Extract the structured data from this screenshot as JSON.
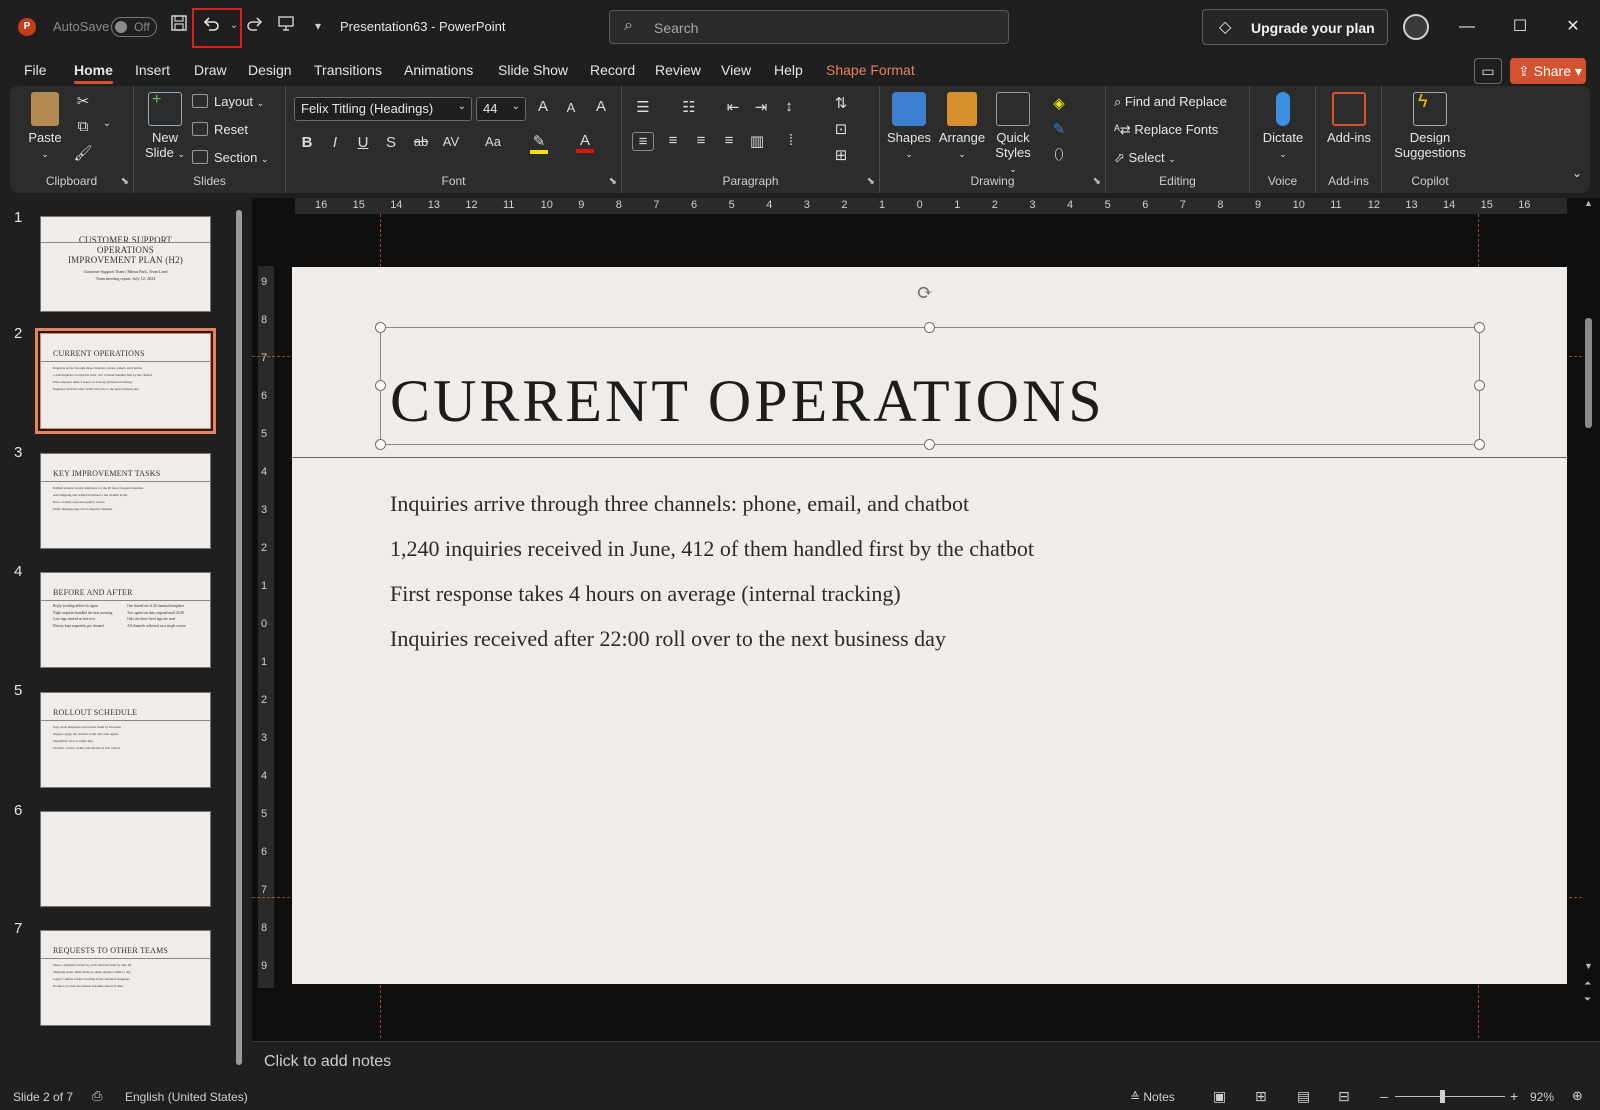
{
  "titlebar": {
    "app_icon": "powerpoint-logo",
    "app_letter": "P",
    "autosave_label": "AutoSave",
    "autosave_state": "Off",
    "document_title": "Presentation63  -  PowerPoint",
    "search_placeholder": "Search",
    "upgrade_label": "Upgrade your plan",
    "minimize_glyph": "—",
    "maximize_glyph": "☐",
    "close_glyph": "✕"
  },
  "menu": {
    "tabs": [
      "File",
      "Home",
      "Insert",
      "Draw",
      "Design",
      "Transitions",
      "Animations",
      "Slide Show",
      "Record",
      "Review",
      "View",
      "Help",
      "Shape Format"
    ],
    "active_tab": "Home",
    "share_label": "Share"
  },
  "ribbon": {
    "clipboard": {
      "label": "Clipboard",
      "paste": "Paste"
    },
    "slides": {
      "label": "Slides",
      "new_slide_1": "New",
      "new_slide_2": "Slide",
      "layout": "Layout",
      "reset": "Reset",
      "section": "Section"
    },
    "font": {
      "label": "Font",
      "font_name": "Felix Titling (Headings)",
      "font_size": "44",
      "bold": "B",
      "italic": "I",
      "underline": "U",
      "shadow": "S",
      "strike": "ab",
      "spacing": "AV",
      "case": "Aa",
      "grow": "A",
      "shrink": "A",
      "clear": "A"
    },
    "paragraph": {
      "label": "Paragraph"
    },
    "drawing": {
      "label": "Drawing",
      "shapes": "Shapes",
      "arrange": "Arrange",
      "quick_styles_1": "Quick",
      "quick_styles_2": "Styles"
    },
    "editing": {
      "label": "Editing",
      "find_replace": "Find and Replace",
      "replace_fonts": "Replace Fonts",
      "select": "Select"
    },
    "voice": {
      "label": "Voice",
      "dictate": "Dictate"
    },
    "addins": {
      "label": "Add-ins",
      "addins": "Add-ins"
    },
    "copilot": {
      "label": "Copilot",
      "design_1": "Design",
      "design_2": "Suggestions"
    }
  },
  "thumbnails": [
    {
      "number": "1",
      "title_lines": [
        "CUSTOMER SUPPORT",
        "OPERATIONS",
        "IMPROVEMENT PLAN (H2)"
      ],
      "subtitle_lines": [
        "Customer Support Team  |  Minsu Park, Team Lead",
        "Team meeting report, July 12, 2024"
      ]
    },
    {
      "number": "2",
      "title": "CURRENT OPERATIONS",
      "bullets": [
        "Inquiries arrive through three channels: phone, email, and chatbot",
        "1,240 inquiries received in June, 412 of them handled first by the chatbot",
        "First response takes 4 hours on average (internal tracking)",
        "Inquiries received after 22:00 roll over to the next business day"
      ]
    },
    {
      "number": "3",
      "title": "KEY IMPROVEMENT TASKS",
      "bullets": [
        "Publish standard reply templates for the 20 most frequent inquiries",
        "Add shipping and refund branches to the chatbot script",
        "Run a weekly response-quality review",
        "Unify message tags across inquiry channels"
      ]
    },
    {
      "number": "4",
      "title": "BEFORE AND AFTER",
      "left_col": [
        "Reply wording differs by agent",
        "Night inquiries handled the next morning",
        "Case tags entered as free text",
        "History kept separately per channel"
      ],
      "right_col": [
        "One shared set of 20 standard templates",
        "Two agents on duty respond until 22:00",
        "Only the three fixed tags are used",
        "All channels collected on a single screen"
      ]
    },
    {
      "number": "5",
      "title": "ROLLOUT SCHEDULE",
      "bullets": [
        "July: draft templates and review them by the team",
        "August: apply the chatbot script and train agents",
        "September: trial of night duty",
        "October: review results and decide on full rollout"
      ]
    },
    {
      "number": "6",
      "title": ""
    },
    {
      "number": "7",
      "title": "REQUESTS TO OTHER TEAMS",
      "bullets": [
        "Share a template review by each relevant team by July 26",
        "Shipping team: share delivery-delay updates within a day",
        "Legal: confirm refund wording in the standard templates",
        "Product: provide the release schedule ahead of time"
      ]
    }
  ],
  "ruler": {
    "horizontal": [
      "16",
      "15",
      "14",
      "13",
      "12",
      "11",
      "10",
      "9",
      "8",
      "7",
      "6",
      "5",
      "4",
      "3",
      "2",
      "1",
      "0",
      "1",
      "2",
      "3",
      "4",
      "5",
      "6",
      "7",
      "8",
      "9",
      "10",
      "11",
      "12",
      "13",
      "14",
      "15",
      "16"
    ],
    "vertical": [
      "9",
      "8",
      "7",
      "6",
      "5",
      "4",
      "3",
      "2",
      "1",
      "0",
      "1",
      "2",
      "3",
      "4",
      "5",
      "6",
      "7",
      "8",
      "9"
    ]
  },
  "slide": {
    "title": "CURRENT OPERATIONS",
    "bullets": [
      "Inquiries arrive through three channels: phone, email, and chatbot",
      "1,240 inquiries received in June, 412 of them handled first by the chatbot",
      "First response takes 4 hours on average (internal tracking)",
      "Inquiries received after 22:00 roll over to the next business day"
    ]
  },
  "notes_placeholder": "Click to add notes",
  "statusbar": {
    "slide_info": "Slide 2 of 7",
    "language": "English (United States)",
    "notes": "Notes",
    "zoom": "92%",
    "zoom_minus": "–",
    "zoom_plus": "+"
  },
  "colors": {
    "accent": "#d35230",
    "shape_format": "#e8835c",
    "highlight_box": "#e02020"
  }
}
